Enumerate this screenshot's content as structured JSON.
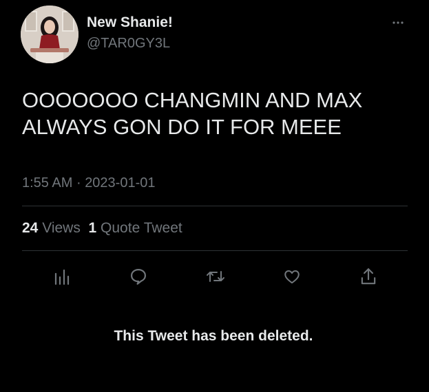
{
  "author": {
    "display_name": "New Shanie!",
    "handle": "@TAR0GY3L",
    "avatar_icon": "profile-photo"
  },
  "more_icon": "more-horizontal-icon",
  "tweet": {
    "text": "OOOOOOO CHANGMIN AND MAX\nALWAYS GON DO IT FOR MEEE",
    "time": "1:55 AM",
    "separator": "·",
    "date": "2023-01-01"
  },
  "stats": {
    "views_count": "24",
    "views_label": "Views",
    "quotes_count": "1",
    "quotes_label": "Quote Tweet"
  },
  "actions": [
    {
      "name": "analytics",
      "icon": "bar-chart-icon"
    },
    {
      "name": "reply",
      "icon": "speech-bubble-icon"
    },
    {
      "name": "retweet",
      "icon": "retweet-arrows-icon"
    },
    {
      "name": "like",
      "icon": "heart-icon"
    },
    {
      "name": "share",
      "icon": "share-upload-icon"
    }
  ],
  "deleted_notice": "This Tweet has been deleted.",
  "colors": {
    "background": "#000000",
    "primary_text": "#e7e9ea",
    "secondary_text": "#71767b",
    "divider": "#2f3336"
  }
}
